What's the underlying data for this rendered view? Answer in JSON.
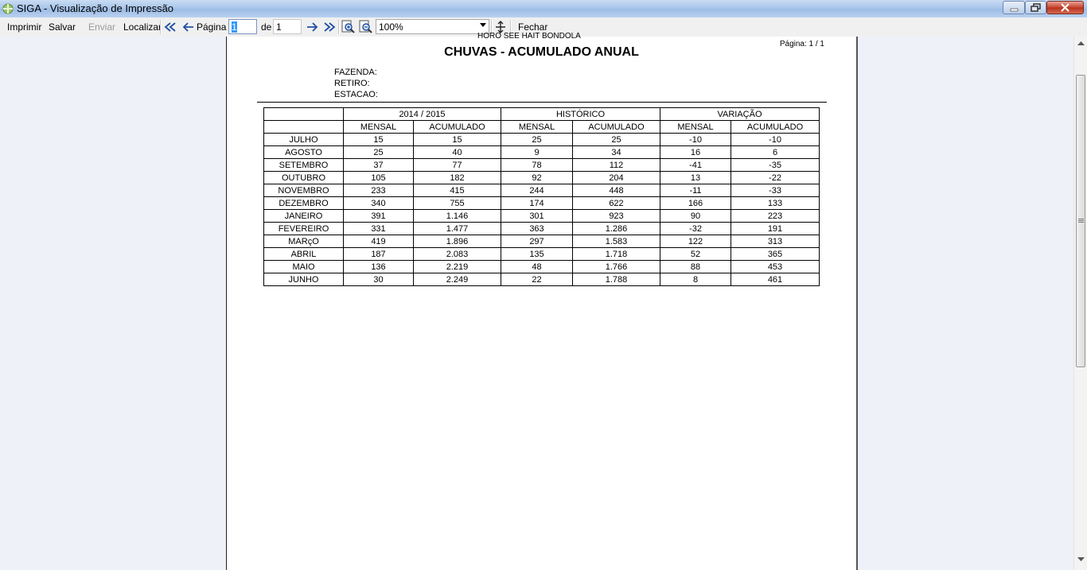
{
  "window": {
    "title": "SIGA - Visualização de Impressão"
  },
  "toolbar": {
    "print": "Imprimir",
    "save": "Salvar",
    "send": "Enviar",
    "find": "Localizar",
    "page_label": "Página",
    "page_value": "1",
    "of_label": "de",
    "total_pages": "1",
    "zoom": "100%",
    "close": "Fechar"
  },
  "report": {
    "cut_header": "HORO SEE HAIT BONDOLA",
    "page_indicator": "Página: 1 / 1",
    "title": "CHUVAS - ACUMULADO ANUAL",
    "fazenda_label": "FAZENDA:",
    "retiro_label": "RETIRO:",
    "estacao_label": "ESTACAO:",
    "groups": [
      "2014 / 2015",
      "HISTÓRICO",
      "VARIAÇÃO"
    ],
    "subheaders": [
      "MENSAL",
      "ACUMULADO",
      "MENSAL",
      "ACUMULADO",
      "MENSAL",
      "ACUMULADO"
    ],
    "rows": [
      [
        "JULHO",
        "15",
        "15",
        "25",
        "25",
        "-10",
        "-10"
      ],
      [
        "AGOSTO",
        "25",
        "40",
        "9",
        "34",
        "16",
        "6"
      ],
      [
        "SETEMBRO",
        "37",
        "77",
        "78",
        "112",
        "-41",
        "-35"
      ],
      [
        "OUTUBRO",
        "105",
        "182",
        "92",
        "204",
        "13",
        "-22"
      ],
      [
        "NOVEMBRO",
        "233",
        "415",
        "244",
        "448",
        "-11",
        "-33"
      ],
      [
        "DEZEMBRO",
        "340",
        "755",
        "174",
        "622",
        "166",
        "133"
      ],
      [
        "JANEIRO",
        "391",
        "1.146",
        "301",
        "923",
        "90",
        "223"
      ],
      [
        "FEVEREIRO",
        "331",
        "1.477",
        "363",
        "1.286",
        "-32",
        "191"
      ],
      [
        "MARçO",
        "419",
        "1.896",
        "297",
        "1.583",
        "122",
        "313"
      ],
      [
        "ABRIL",
        "187",
        "2.083",
        "135",
        "1.718",
        "52",
        "365"
      ],
      [
        "MAIO",
        "136",
        "2.219",
        "48",
        "1.766",
        "88",
        "453"
      ],
      [
        "JUNHO",
        "30",
        "2.249",
        "22",
        "1.788",
        "8",
        "461"
      ]
    ]
  }
}
